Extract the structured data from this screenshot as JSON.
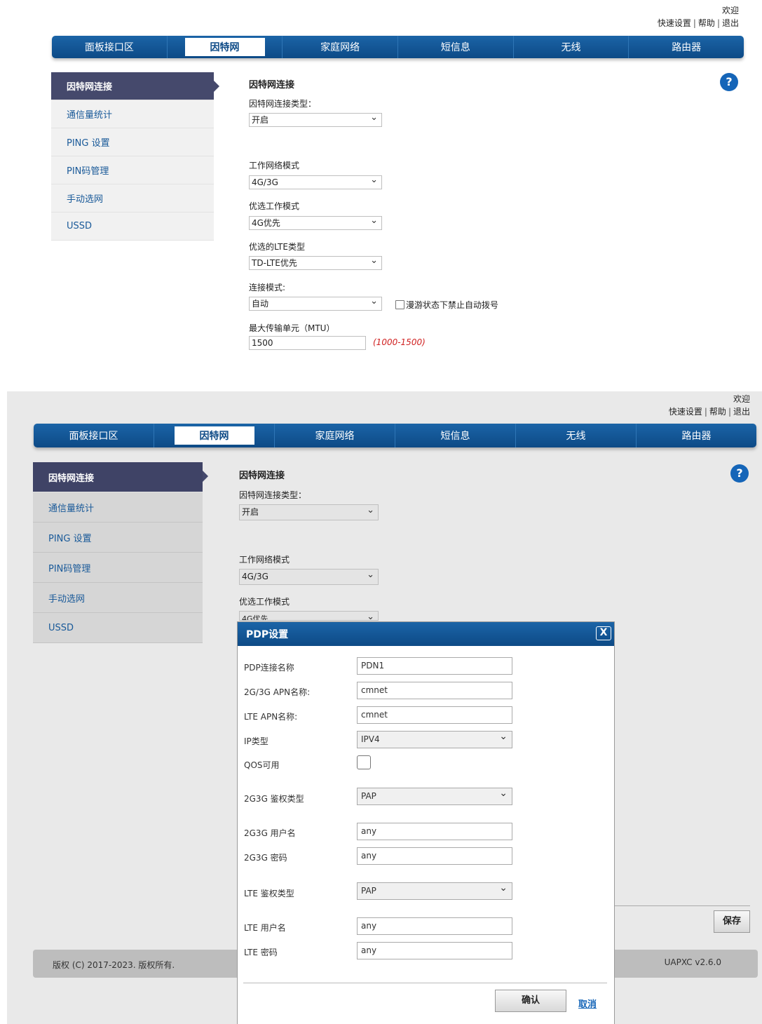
{
  "header": {
    "welcome": "欢迎",
    "quick_setup": "快速设置",
    "help": "帮助",
    "logout": "退出",
    "sep": "|"
  },
  "nav": {
    "tabs": [
      "面板接口区",
      "因特网",
      "家庭网络",
      "短信息",
      "无线",
      "路由器"
    ],
    "active": 1
  },
  "sidebar": {
    "items": [
      "因特网连接",
      "通信量统计",
      "PING 设置",
      "PIN码管理",
      "手动选网",
      "USSD"
    ],
    "active": 0
  },
  "form": {
    "title": "因特网连接",
    "conn_type_label": "因特网连接类型：",
    "conn_type_value": "开启",
    "work_mode_label": "工作网络模式",
    "work_mode_value": "4G/3G",
    "pref_mode_label": "优选工作模式",
    "pref_mode_value": "4G优先",
    "pref_lte_label": "优选的LTE类型",
    "pref_lte_value": "TD-LTE优先",
    "connect_mode_label": "连接模式:",
    "connect_mode_value": "自动",
    "roaming_label": "漫游状态下禁止自动拨号",
    "mtu_label": "最大传输单元（MTU）",
    "mtu_value": "1500",
    "mtu_hint": "(1000-1500)",
    "help_icon": "?",
    "pref_mode_partial": "4G优先"
  },
  "modal": {
    "title": "PDP设置",
    "close": "X",
    "rows": [
      {
        "label": "PDP连接名称",
        "value": "PDN1"
      },
      {
        "label": "2G/3G APN名称:",
        "value": "cmnet"
      },
      {
        "label": "LTE APN名称:",
        "value": "cmnet"
      },
      {
        "label": "IP类型",
        "value": "IPV4"
      },
      {
        "label": "QOS可用",
        "value": ""
      },
      {
        "label": "2G3G 鉴权类型",
        "value": "PAP"
      },
      {
        "label": "2G3G 用户名",
        "value": "any"
      },
      {
        "label": "2G3G 密码",
        "value": "any"
      },
      {
        "label": "LTE 鉴权类型",
        "value": "PAP"
      },
      {
        "label": "LTE 用户名",
        "value": "any"
      },
      {
        "label": "LTE 密码",
        "value": "any"
      }
    ],
    "confirm": "确认",
    "cancel": "取消"
  },
  "page": {
    "save": "保存",
    "copyright": "版权 (C) 2017-2023. 版权所有.",
    "version": "UAPXC v2.6.0"
  }
}
